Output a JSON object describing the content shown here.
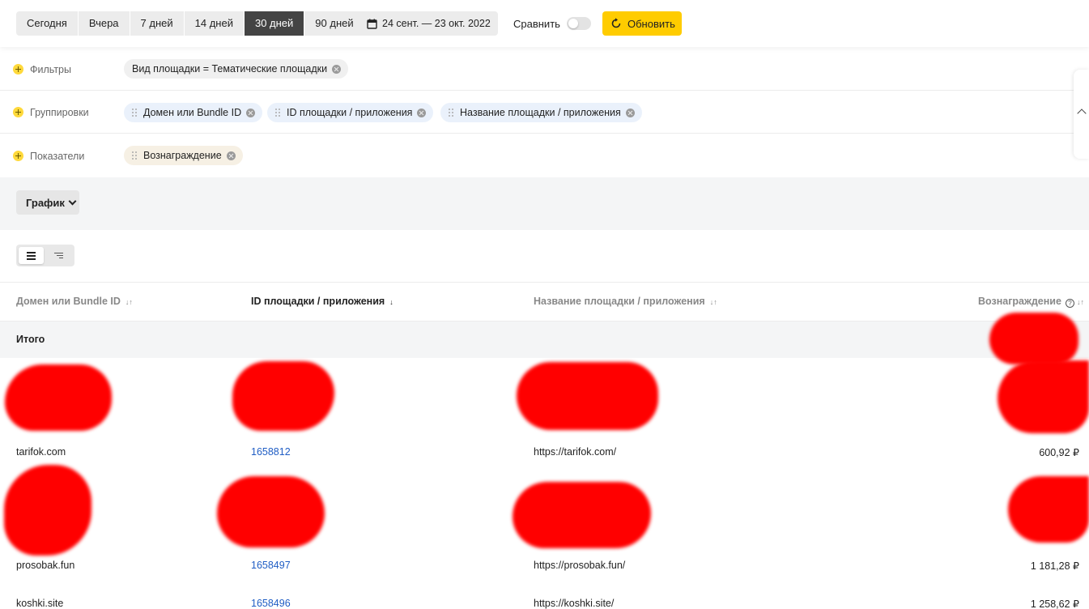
{
  "toolbar": {
    "periods": [
      "Сегодня",
      "Вчера",
      "7 дней",
      "14 дней",
      "30 дней",
      "90 дней"
    ],
    "active_period": "30 дней",
    "date_range": "24 сент. — 23 окт. 2022",
    "compare_label": "Сравнить",
    "compare_enabled": false,
    "refresh_label": "Обновить",
    "accent_color": "#ffcc00"
  },
  "filters": {
    "label": "Фильтры",
    "chips": [
      "Вид площадки = Тематические площадки"
    ]
  },
  "groupings": {
    "label": "Группировки",
    "chips": [
      "Домен или Bundle ID",
      "ID площадки / приложения",
      "Название площадки / приложения"
    ]
  },
  "metrics": {
    "label": "Показатели",
    "chips": [
      "Вознаграждение"
    ]
  },
  "chart": {
    "button_label": "График"
  },
  "table": {
    "columns": [
      "Домен или Bundle ID",
      "ID площадки / приложения",
      "Название площадки / приложения",
      "Вознаграждение"
    ],
    "sort_icon": "↓↑",
    "sorted_icon": "↓",
    "help_icon": "?",
    "total_label": "Итого",
    "rows": [
      {
        "domain": "tarifok.com",
        "id": "1658812",
        "name": "https://tarifok.com/",
        "reward": "600,92 ₽"
      },
      {
        "domain": "prosobak.fun",
        "id": "1658497",
        "name": "https://prosobak.fun/",
        "reward": "1 181,28 ₽"
      },
      {
        "domain": "koshki.site",
        "id": "1658496",
        "name": "https://koshki.site/",
        "reward": "1 258,62 ₽"
      }
    ]
  }
}
